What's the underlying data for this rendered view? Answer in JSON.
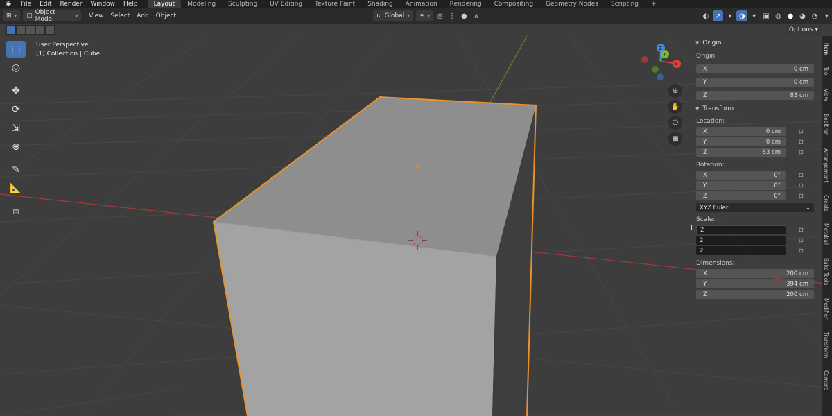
{
  "menu": [
    "File",
    "Edit",
    "Render",
    "Window",
    "Help"
  ],
  "workspaces": [
    "Layout",
    "Modeling",
    "Sculpting",
    "UV Editing",
    "Texture Paint",
    "Shading",
    "Animation",
    "Rendering",
    "Compositing",
    "Geometry Nodes",
    "Scripting"
  ],
  "active_workspace": "Layout",
  "header": {
    "mode": "Object Mode",
    "items": [
      "View",
      "Select",
      "Add",
      "Object"
    ],
    "transform_orientation": "Global",
    "options": "Options"
  },
  "viewport": {
    "view_name": "User Perspective",
    "collection": "(1) Collection | Cube",
    "selection_outline_color": "#e8932e",
    "grid_x_axis_color": "#a83838",
    "grid_y_axis_color": "#5a8a2a"
  },
  "gizmo": {
    "x": "X",
    "y": "Y",
    "z": "Z"
  },
  "sidebar": {
    "origin_title": "Origin",
    "origin_label": "Origin",
    "origin": [
      {
        "axis": "X",
        "value": "0 cm"
      },
      {
        "axis": "Y",
        "value": "0 cm"
      },
      {
        "axis": "Z",
        "value": "83 cm"
      }
    ],
    "transform_title": "Transform",
    "location_label": "Location:",
    "location": [
      {
        "axis": "X",
        "value": "0 cm"
      },
      {
        "axis": "Y",
        "value": "0 cm"
      },
      {
        "axis": "Z",
        "value": "83 cm"
      }
    ],
    "rotation_label": "Rotation:",
    "rotation": [
      {
        "axis": "X",
        "value": "0°"
      },
      {
        "axis": "Y",
        "value": "0°"
      },
      {
        "axis": "Z",
        "value": "0°"
      }
    ],
    "rotation_mode": "XYZ Euler",
    "scale_label": "Scale:",
    "scale": [
      "2",
      "2",
      "2"
    ],
    "dimensions_label": "Dimensions:",
    "dimensions": [
      {
        "axis": "X",
        "value": "200 cm"
      },
      {
        "axis": "Y",
        "value": "394 cm"
      },
      {
        "axis": "Z",
        "value": "200 cm"
      }
    ]
  },
  "tabs": [
    "Item",
    "Tool",
    "View",
    "Booltron",
    "Arrangement",
    "Create",
    "Metaball",
    "Bake Tools",
    "Modifier",
    "Transform",
    "Camera"
  ]
}
